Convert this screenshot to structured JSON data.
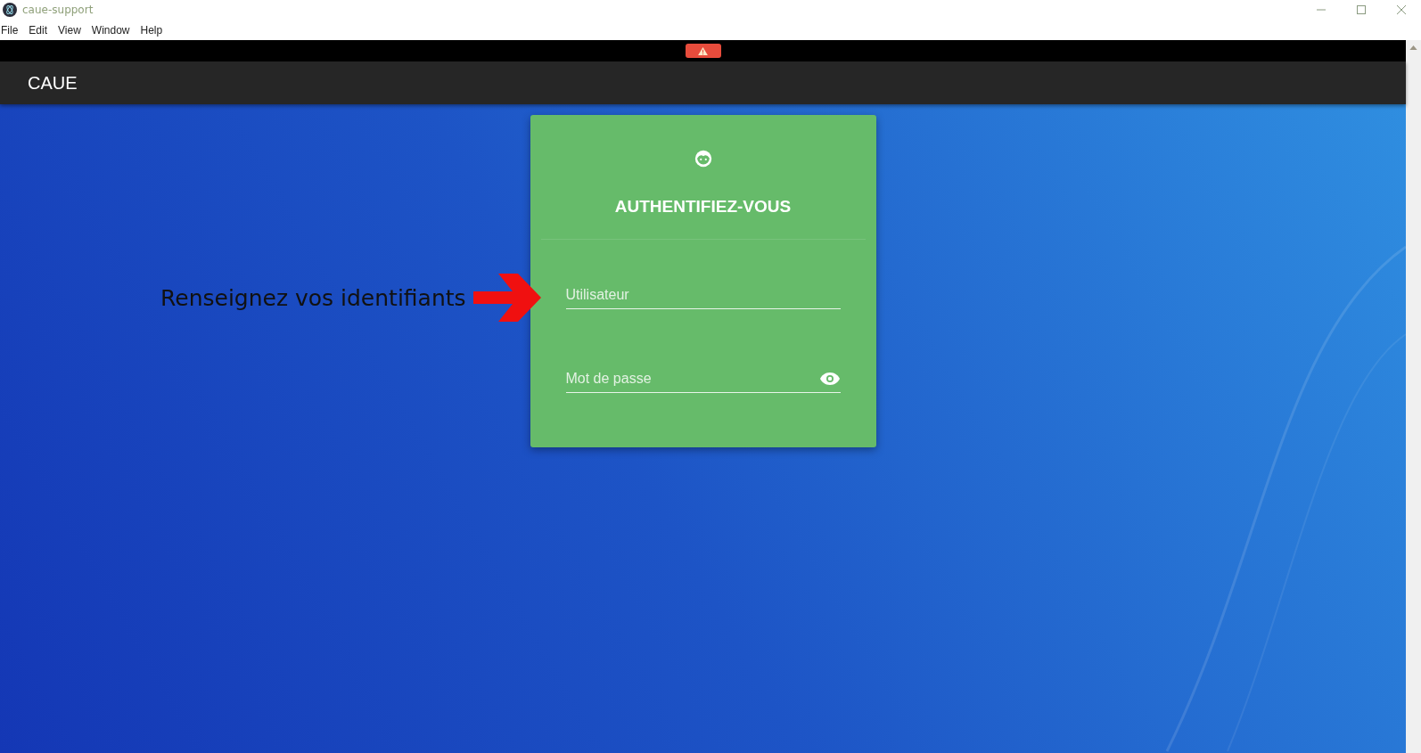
{
  "window": {
    "title": "caue-support"
  },
  "menu": [
    "File",
    "Edit",
    "View",
    "Window",
    "Help"
  ],
  "app_bar": {
    "title": "CAUE"
  },
  "login": {
    "heading": "AUTHENTIFIEZ-VOUS",
    "fields": [
      {
        "kind": "text",
        "placeholder": "Utilisateur"
      },
      {
        "kind": "password",
        "placeholder": "Mot de passe"
      }
    ]
  },
  "annotation": {
    "text": "Renseignez vos identifiants"
  }
}
